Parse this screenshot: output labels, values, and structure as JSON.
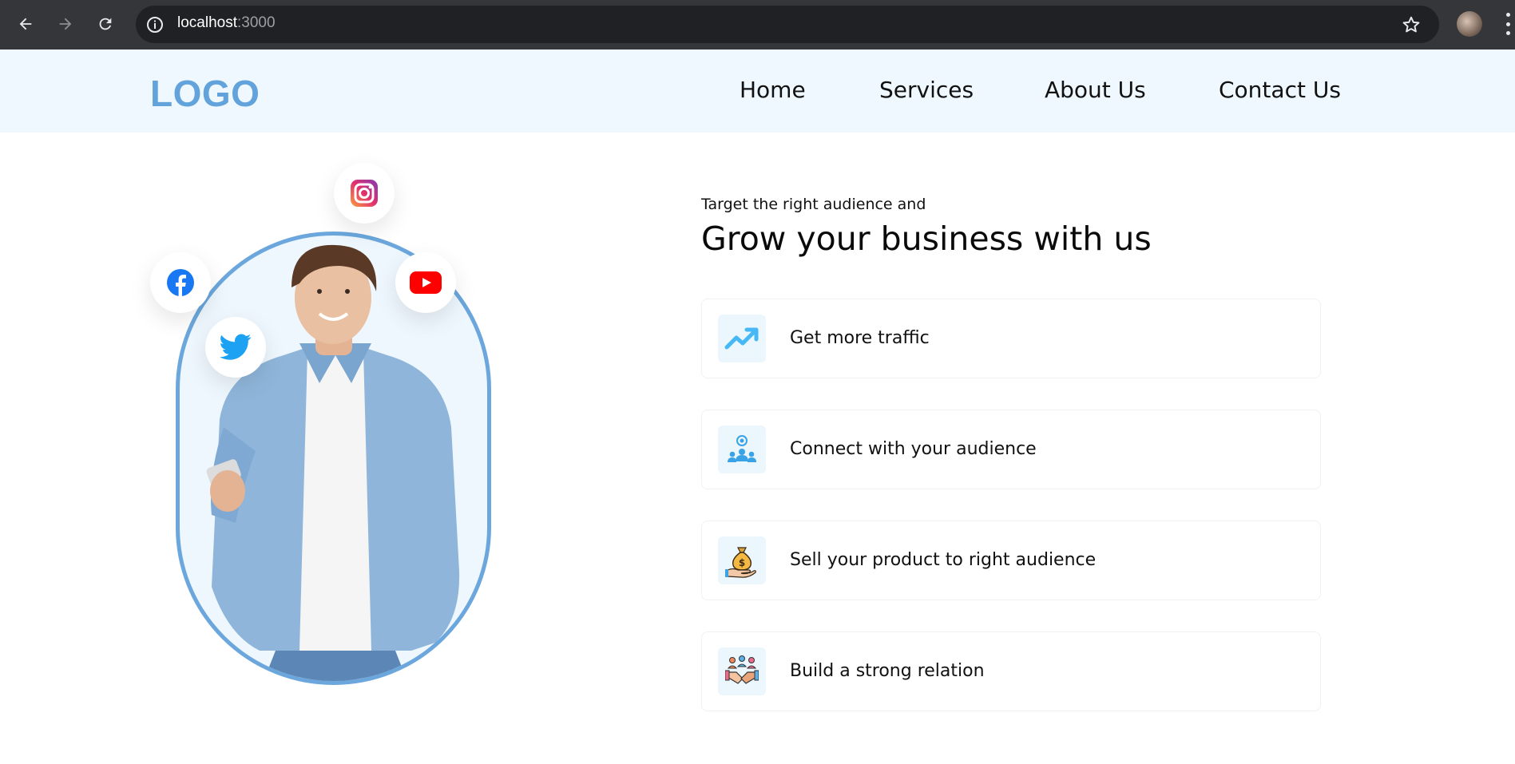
{
  "browser": {
    "url_host": "localhost",
    "url_port": ":3000",
    "icons": [
      "back-icon",
      "forward-icon",
      "reload-icon",
      "info-icon",
      "star-icon",
      "profile-avatar",
      "menu-icon"
    ]
  },
  "header": {
    "logo": "LOGO",
    "nav": [
      "Home",
      "Services",
      "About Us",
      "Contact Us"
    ]
  },
  "hero": {
    "eyebrow": "Target the right audience and",
    "headline": "Grow your business with us",
    "social_icons": [
      "instagram-icon",
      "facebook-icon",
      "youtube-icon",
      "twitter-icon"
    ],
    "features": [
      {
        "label": "Get more traffic",
        "icon": "trending-up-icon"
      },
      {
        "label": "Connect with your audience",
        "icon": "audience-target-icon"
      },
      {
        "label": "Sell your product to right audience",
        "icon": "money-bag-hand-icon"
      },
      {
        "label": "Build a strong relation",
        "icon": "handshake-icon"
      }
    ]
  },
  "colors": {
    "brand_blue": "#63a3dc",
    "header_bg": "#eff8fe",
    "arch_border": "#6ba7dd",
    "icon_bg": "#ebf6fd"
  }
}
